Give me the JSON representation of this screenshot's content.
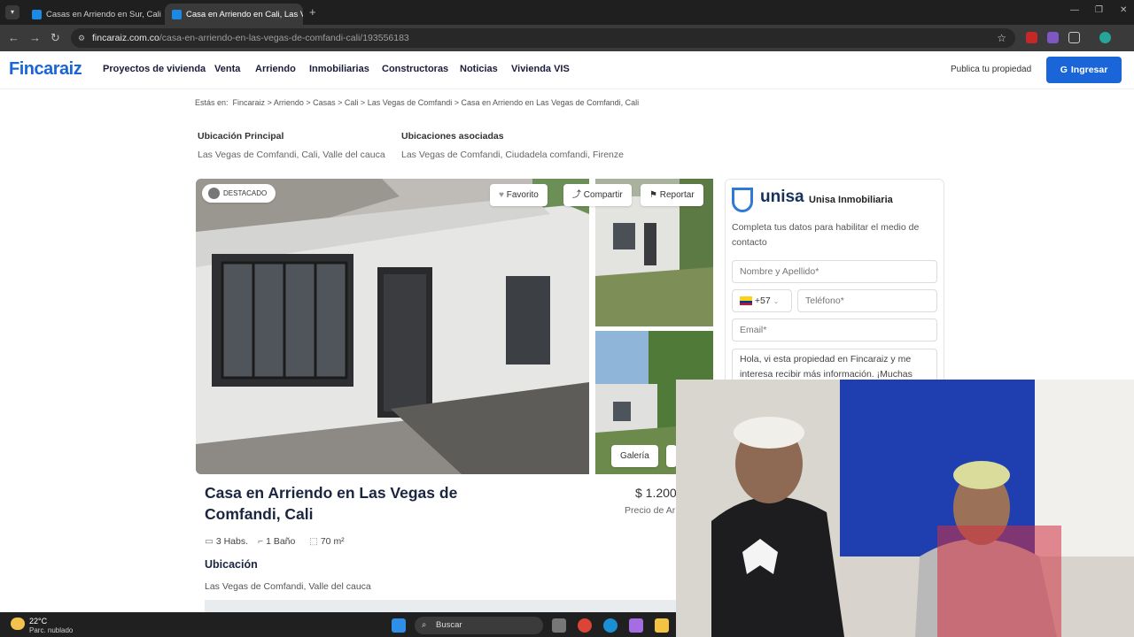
{
  "browser": {
    "tabs": [
      {
        "title": "Casas en Arriendo en Sur, Cali y"
      },
      {
        "title": "Casa en Arriendo en Cali, Las V"
      }
    ],
    "url_domain": "fincaraiz.com.co",
    "url_path": "/casa-en-arriendo-en-las-vegas-de-comfandi-cali/193556183"
  },
  "header": {
    "logo": "Fincaraiz",
    "nav": [
      "Proyectos de vivienda",
      "Venta",
      "Arriendo",
      "Inmobiliarias",
      "Constructoras",
      "Noticias",
      "Vivienda VIS"
    ],
    "publica": "Publica tu propiedad",
    "ingresar": "Ingresar"
  },
  "breadcrumb": {
    "prefix": "Estás en:",
    "items": [
      "Fincaraiz",
      "Arriendo",
      "Casas",
      "Cali",
      "Las Vegas de Comfandi",
      "Casa en Arriendo en Las Vegas de Comfandi, Cali"
    ]
  },
  "location": {
    "principal_label": "Ubicación Principal",
    "principal_value": "Las Vegas de Comfandi, Cali, Valle del cauca",
    "asociadas_label": "Ubicaciones asociadas",
    "asociadas_value": "Las Vegas de Comfandi, Ciudadela comfandi, Firenze"
  },
  "gallery": {
    "badge": "DESTACADO",
    "favorito": "Favorito",
    "compartir": "Compartir",
    "reportar": "Reportar",
    "galeria": "Galería"
  },
  "listing": {
    "title": "Casa en Arriendo en Las Vegas de Comfandi, Cali",
    "price": "$ 1.200",
    "price_label": "Precio de Ar",
    "habs": "3 Habs.",
    "banos": "1 Baño",
    "area": "70 m²",
    "ubicacion_heading": "Ubicación",
    "ubicacion_value": "Las Vegas de Comfandi, Valle del cauca"
  },
  "contact": {
    "logo": "unisa",
    "name": "Unisa Inmobiliaria",
    "desc": "Completa tus datos para habilitar el medio de contacto",
    "name_placeholder": "Nombre y Apellido*",
    "country_code": "+57",
    "phone_placeholder": "Teléfono*",
    "email_placeholder": "Email*",
    "message": "Hola, vi esta propiedad en Fincaraiz y me interesa recibir más información. ¡Muchas"
  },
  "taskbar": {
    "temp": "22°C",
    "weather": "Parc. nublado",
    "search": "Buscar"
  },
  "colors": {
    "brand": "#1a66d9",
    "dark_text": "#1b2540"
  }
}
